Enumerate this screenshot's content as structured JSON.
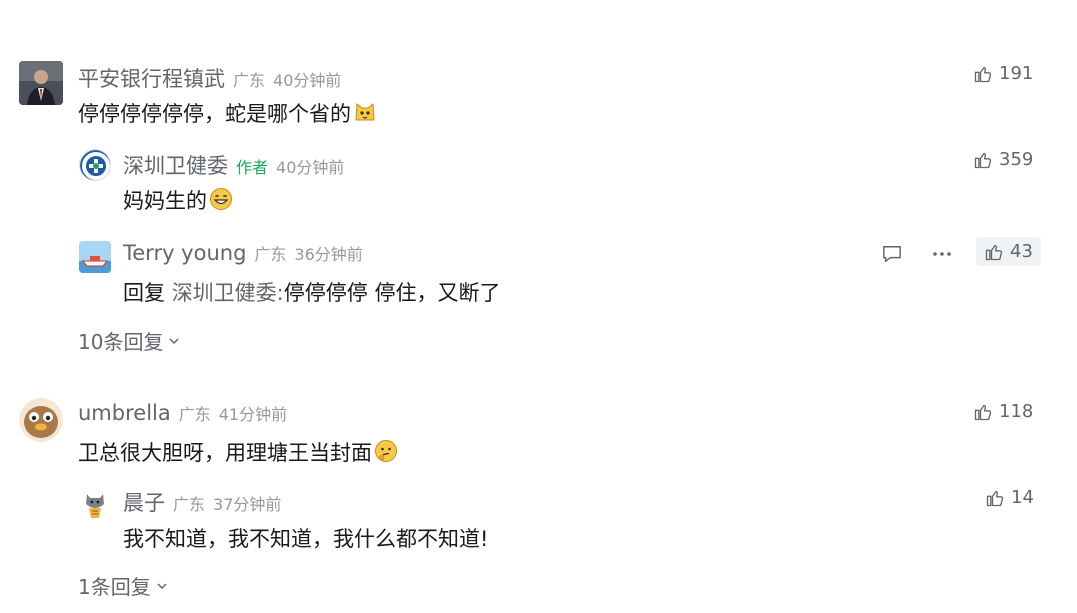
{
  "comments": [
    {
      "user": "平安银行程镇武",
      "location": "广东",
      "time": "40分钟前",
      "text": "停停停停停停，蛇是哪个省的",
      "emoji": "cat-face-emoji",
      "likes": "191",
      "replies": [
        {
          "user": "深圳卫健委",
          "author_tag": "作者",
          "time": "40分钟前",
          "text": "妈妈生的",
          "emoji": "grinning-face-emoji",
          "likes": "359"
        },
        {
          "user": "Terry young",
          "location": "广东",
          "time": "36分钟前",
          "reply_prefix": "回复",
          "reply_target": "深圳卫健委:",
          "text": "停停停停 停住，又断了",
          "likes": "43"
        }
      ],
      "more_replies": "10条回复"
    },
    {
      "user": "umbrella",
      "location": "广东",
      "time": "41分钟前",
      "text": "卫总很大胆呀，用理塘王当封面",
      "emoji": "thinking-face-emoji",
      "likes": "118",
      "replies": [
        {
          "user": "晨子",
          "location": "广东",
          "time": "37分钟前",
          "text": "我不知道，我不知道，我什么都不知道!",
          "likes": "14"
        }
      ],
      "more_replies": "1条回复"
    }
  ],
  "colors": {
    "name": "#61666d",
    "meta": "#9499a0",
    "author_tag": "#1fa85a",
    "content": "#18191c"
  }
}
